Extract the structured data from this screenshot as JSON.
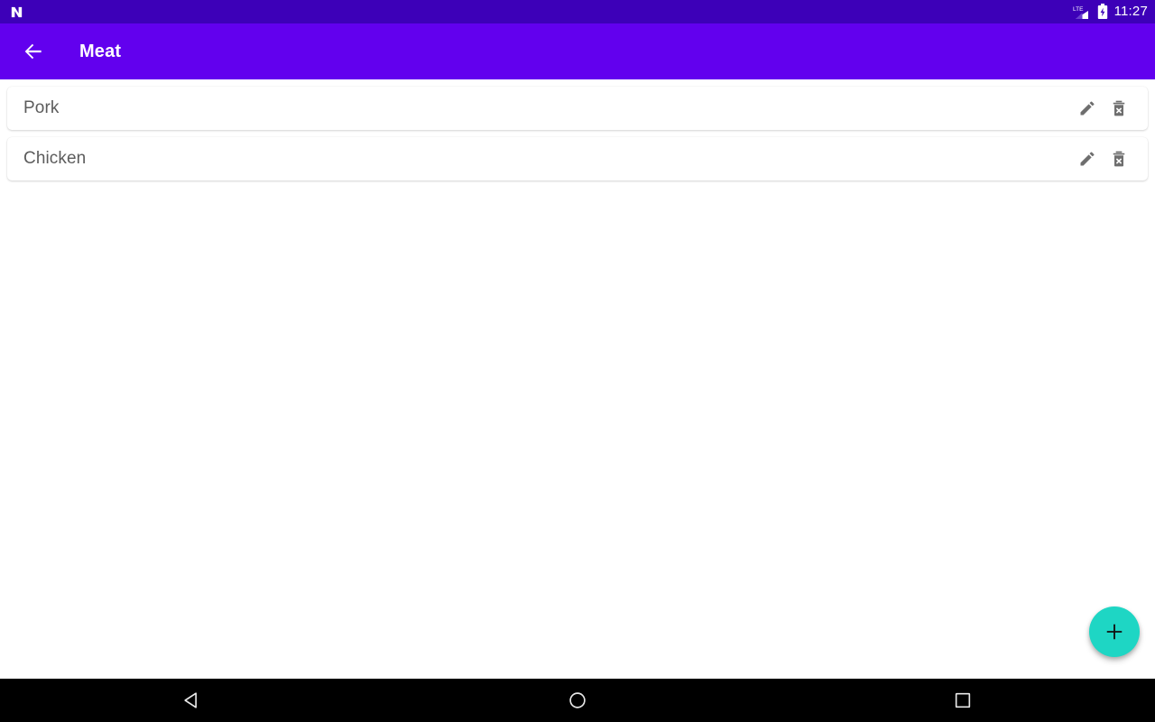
{
  "status_bar": {
    "notification_icon": "app-n-icon",
    "signal_icon": "lte-signal-icon",
    "signal_label": "LTE",
    "battery_icon": "battery-charging-icon",
    "time": "11:27",
    "background_color": "#3d00b8"
  },
  "app_bar": {
    "back_icon": "back-arrow-icon",
    "title": "Meat",
    "background_color": "#6200ee",
    "text_color": "#ffffff"
  },
  "list": {
    "items": [
      {
        "label": "Pork",
        "edit_icon": "pencil-icon",
        "delete_icon": "trash-x-icon"
      },
      {
        "label": "Chicken",
        "edit_icon": "pencil-icon",
        "delete_icon": "trash-x-icon"
      }
    ]
  },
  "fab": {
    "icon": "plus-icon",
    "color": "#1ed6c4"
  },
  "nav_bar": {
    "back_label": "back-triangle-icon",
    "home_label": "home-circle-icon",
    "recents_label": "recents-square-icon",
    "background_color": "#000000"
  }
}
